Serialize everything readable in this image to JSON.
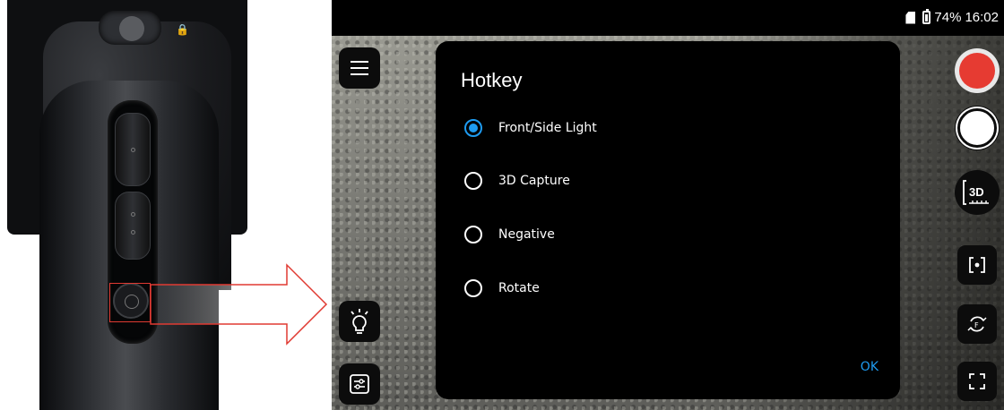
{
  "status_bar": {
    "battery": "74%",
    "time": "16:02"
  },
  "dialog": {
    "title": "Hotkey",
    "options": [
      {
        "label": "Front/Side Light",
        "selected": true
      },
      {
        "label": "3D Capture",
        "selected": false
      },
      {
        "label": "Negative",
        "selected": false
      },
      {
        "label": "Rotate",
        "selected": false
      }
    ],
    "ok_label": "OK"
  },
  "right_toolbar": {
    "three_d_label": "3D"
  },
  "colors": {
    "accent": "#1e9bf0",
    "record": "#e63b32",
    "highlight": "#e03a32"
  },
  "icons": [
    "menu-icon",
    "bulb-icon",
    "sliders-icon",
    "record-icon",
    "shutter-icon",
    "3d-measure-icon",
    "focus-icon",
    "flip-camera-icon",
    "fullscreen-icon",
    "sd-card-icon",
    "battery-icon",
    "lock-icon"
  ]
}
